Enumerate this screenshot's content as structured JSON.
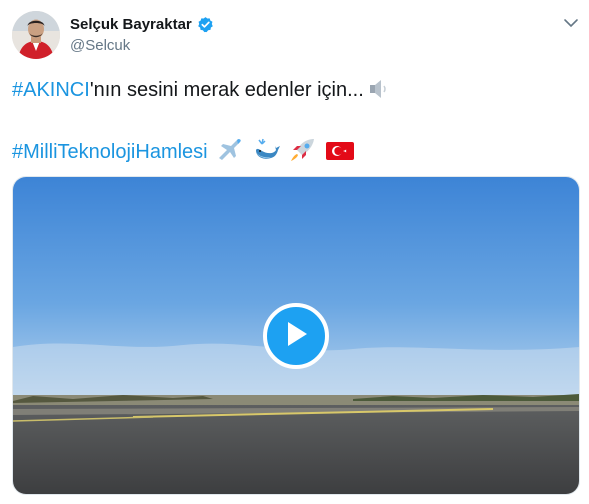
{
  "user": {
    "display_name": "Selçuk Bayraktar",
    "handle": "@Selcuk",
    "verified_icon": "verified-badge-icon"
  },
  "tweet": {
    "hashtag1": "#AKINCI",
    "text1": "'nın sesini merak edenler için...",
    "emoji1": "speaker-icon",
    "hashtag2": "#MilliTeknolojiHamlesi",
    "emojis2": [
      "airplane-icon",
      "whale-icon",
      "rocket-icon",
      "turkey-flag-icon"
    ]
  },
  "media": {
    "type": "video",
    "play_icon": "play-icon"
  },
  "colors": {
    "link": "#1b95e0",
    "play_button": "#1da1f2",
    "text": "#14171a",
    "secondary": "#657786"
  }
}
